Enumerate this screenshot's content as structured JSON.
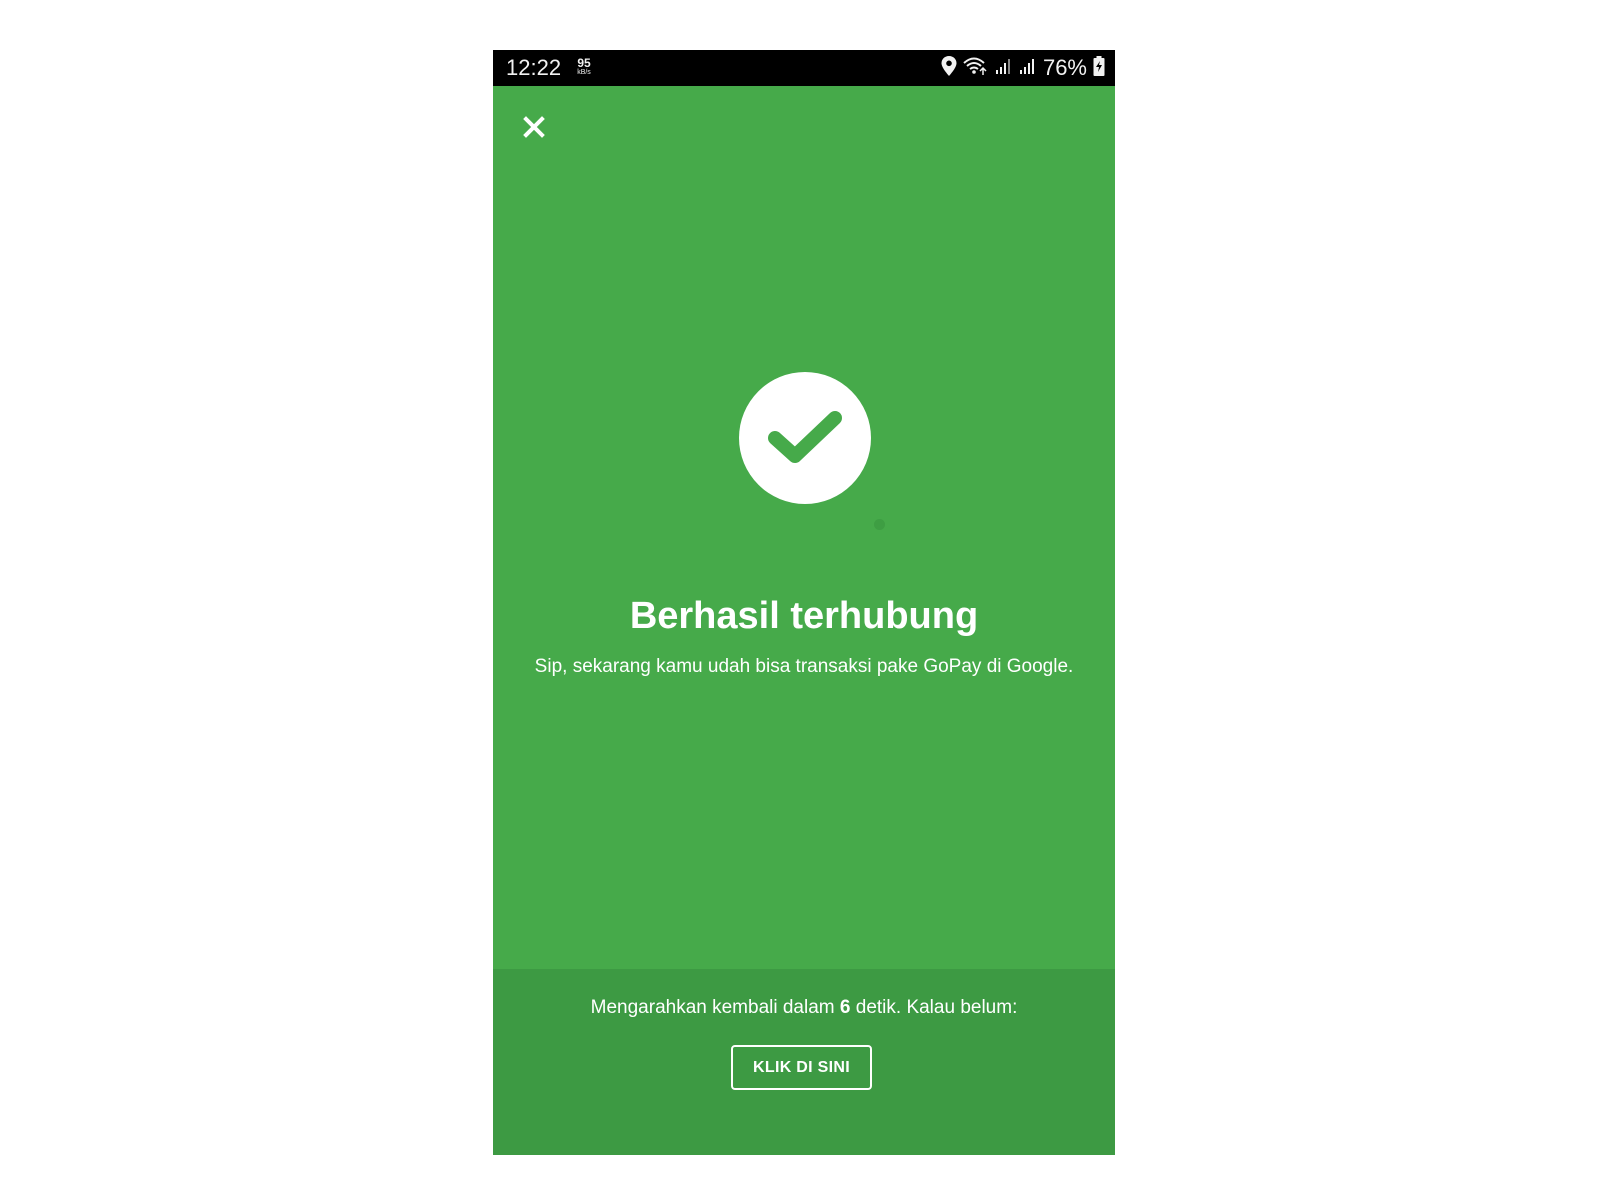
{
  "status_bar": {
    "time": "12:22",
    "net_speed": "95",
    "net_speed_unit": "kB/s",
    "battery": "76%",
    "icons": [
      "location-icon",
      "wifi-icon",
      "signal-icon",
      "signal-icon",
      "battery-charging-icon"
    ]
  },
  "header": {
    "close_icon": "close-icon"
  },
  "main": {
    "status_icon": "checkmark-icon",
    "title": "Berhasil terhubung",
    "subtitle": "Sip, sekarang kamu udah bisa transaksi pake GoPay di Google."
  },
  "footer": {
    "redirect_prefix": "Mengarahkan kembali dalam",
    "countdown": "6",
    "redirect_suffix": "detik. Kalau belum:",
    "button_label": "KLIK DI SINI"
  },
  "colors": {
    "background_green": "#46aa4a",
    "footer_green": "#3d9a43",
    "check_green": "#46aa4a",
    "white": "#ffffff",
    "status_bar": "#000000"
  }
}
